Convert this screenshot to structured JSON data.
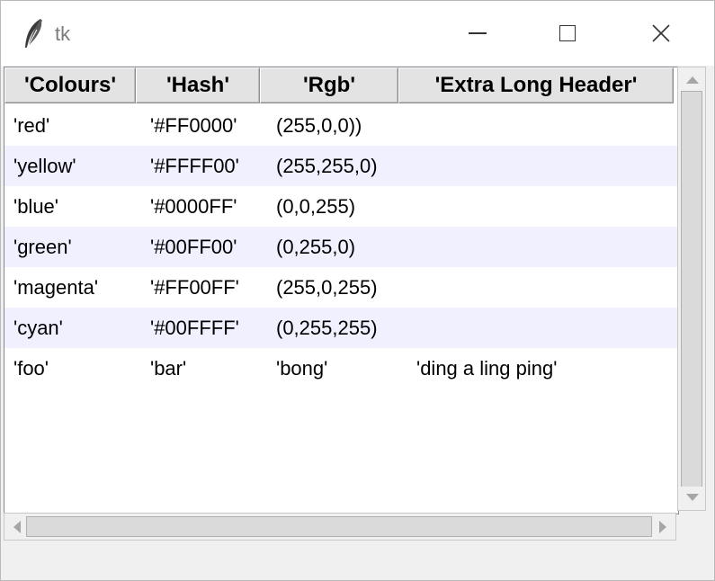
{
  "window": {
    "title": "tk",
    "icon": "tk-feather-icon"
  },
  "table": {
    "headers": [
      "'Colours'",
      "'Hash'",
      "'Rgb'",
      "'Extra Long Header'"
    ],
    "rows": [
      [
        "'red'",
        "'#FF0000'",
        "(255,0,0))",
        ""
      ],
      [
        "'yellow'",
        "'#FFFF00'",
        "(255,255,0)",
        ""
      ],
      [
        "'blue'",
        "'#0000FF'",
        "(0,0,255)",
        ""
      ],
      [
        "'green'",
        "'#00FF00'",
        "(0,255,0)",
        ""
      ],
      [
        "'magenta'",
        "'#FF00FF'",
        "(255,0,255)",
        ""
      ],
      [
        "'cyan'",
        "'#00FFFF'",
        "(0,255,255)",
        ""
      ],
      [
        "'foo'",
        "'bar'",
        "'bong'",
        "'ding a ling ping'"
      ]
    ],
    "alt_row_color": "#f0f0ff"
  }
}
